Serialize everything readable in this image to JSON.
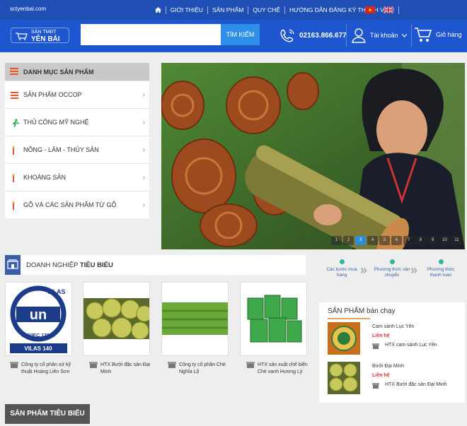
{
  "topbar": {
    "site": "sctyenbai.com",
    "nav": [
      "GIỚI THIỆU",
      "SẢN PHẨM",
      "QUY CHẾ",
      "HƯỚNG DẪN ĐĂNG KÝ THÀNH VIÊN"
    ]
  },
  "header": {
    "logo_line1": "SÀN TMĐT",
    "logo_line2": "YÊN BÁI",
    "search_button": "TÌM KIẾM",
    "search_placeholder": "",
    "phone": "02163.866.677",
    "account": "Tài khoản",
    "cart": "Giỏ hàng"
  },
  "menu": {
    "title": "DANH MỤC SẢN PHẨM",
    "items": [
      {
        "label": "SẢN PHẨM OCCOP",
        "icon": "list-icon"
      },
      {
        "label": "THỦ CÔNG MỸ NGHỆ",
        "icon": "handcraft-icon"
      },
      {
        "label": "NÔNG - LÂM - THỦY SẢN",
        "icon": "agriculture-icon"
      },
      {
        "label": "KHOÁNG SẢN",
        "icon": "mineral-icon"
      },
      {
        "label": "GỖ VÀ CÁC SẢN PHẨM TỪ GỖ",
        "icon": "wood-icon"
      }
    ]
  },
  "banner": {
    "slides": [
      "1",
      "2",
      "3",
      "4",
      "5",
      "6",
      "7",
      "8",
      "9",
      "10",
      "11"
    ],
    "active": 3
  },
  "business": {
    "title_normal": "DOANH NGHIỆP",
    "title_bold": "TIÊU BIỂU",
    "cards": [
      {
        "name": "Công ty cổ phần sử kỹ thuật Hoàng Liên Sơn",
        "image": "vilas-logo"
      },
      {
        "name": "HTX Bưởi đặc sản Đại Minh",
        "image": "pomelo"
      },
      {
        "name": "Công ty cổ phần Chè Nghĩa Lộ",
        "image": "tea-field"
      },
      {
        "name": "HTX sản xuất chế biến Chè xanh Hương Lý",
        "image": "tea-packs"
      }
    ],
    "vilas_text": "VILAS",
    "vilas_un": "un",
    "vilas_iso": "ISO/IEC 17025",
    "vilas_num": "VILAS 140"
  },
  "steps": [
    {
      "label": "Các bước mua hàng",
      "color": "#2fb8a0"
    },
    {
      "label": "Phương thức vận chuyển",
      "color": "#2fb8a0"
    },
    {
      "label": "Phương thức thanh toán",
      "color": "#2fb8a0"
    }
  ],
  "bestsellers": {
    "title_normal": "SẢN PHẨM",
    "title_rest": "bán chạy",
    "items": [
      {
        "name": "Cam sành Lục Yên",
        "price": "Liên hệ",
        "shop": "HTX cam sành Lục Yên"
      },
      {
        "name": "Bưởi Đại Minh",
        "price": "Liên hệ",
        "shop": "HTX Bưởi đặc sản Đại Minh"
      }
    ]
  },
  "featured": {
    "title": "SẢN PHẨM TIÊU BIỂU"
  }
}
